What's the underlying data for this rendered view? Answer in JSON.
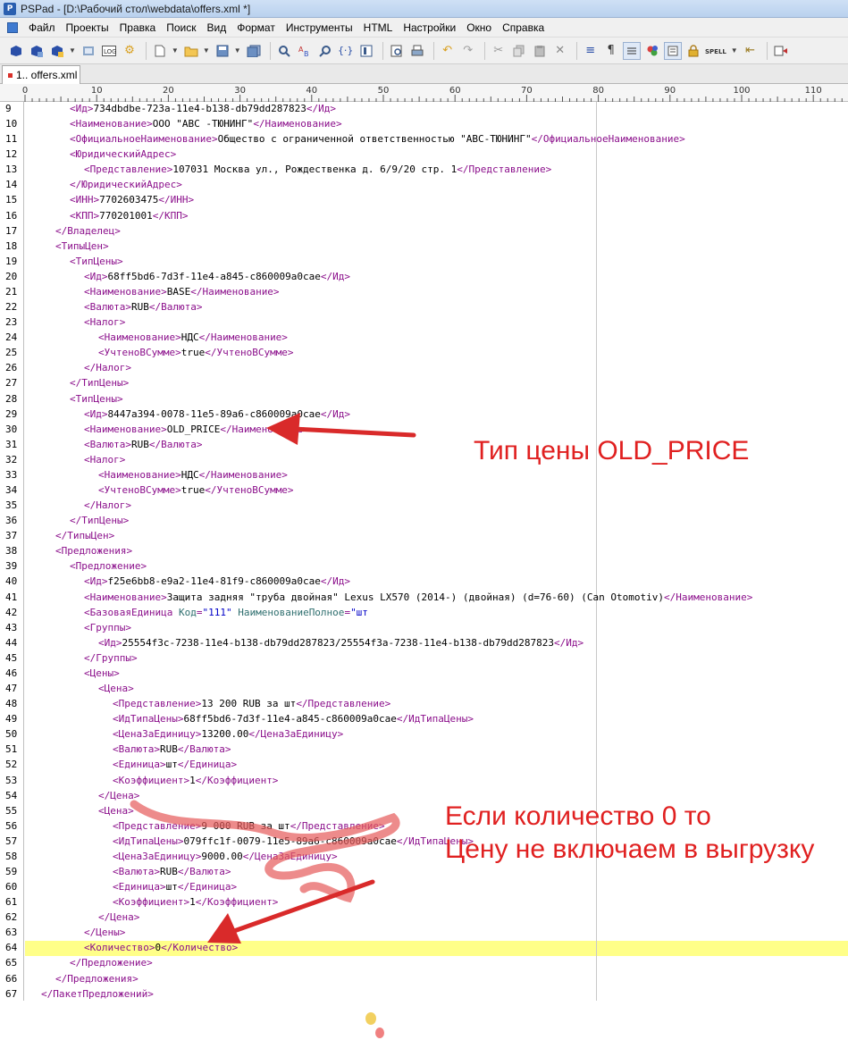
{
  "window": {
    "app_icon": "pspad-icon",
    "title": "PSPad - [D:\\Рабочий стол\\webdata\\offers.xml *]"
  },
  "menu": {
    "items": [
      "Файл",
      "Проекты",
      "Правка",
      "Поиск",
      "Вид",
      "Формат",
      "Инструменты",
      "HTML",
      "Настройки",
      "Окно",
      "Справка"
    ]
  },
  "toolbar": {
    "buttons": [
      "open-project-icon",
      "save-project-icon",
      "project-options-icon",
      "close-project-icon",
      "log-icon",
      "settings-icon",
      "new-file-icon",
      "open-file-icon",
      "save-icon",
      "save-all-icon",
      "find-icon",
      "replace-icon",
      "find-in-files-icon",
      "bookmark-icon",
      "preview-icon",
      "print-icon",
      "undo-icon",
      "redo-icon",
      "cut-icon",
      "copy-icon",
      "paste-icon",
      "delete-icon",
      "word-wrap-icon",
      "pilcrow-icon",
      "column-mode-icon",
      "color-icon",
      "hex-edit-icon",
      "lock-icon",
      "spell-icon",
      "macro-icon",
      "compile-icon"
    ],
    "spell_label": "SPELL",
    "log_label": "LOG"
  },
  "tabs": [
    {
      "label": "1.. offers.xml",
      "active": true
    }
  ],
  "ruler": {
    "labels": [
      "0",
      "10",
      "20",
      "30",
      "40",
      "50",
      "60",
      "70",
      "80",
      "90",
      "100",
      "110"
    ]
  },
  "editor": {
    "highlighted_line": 64,
    "lines": [
      {
        "n": "9",
        "indent": 3,
        "parts": [
          [
            "tg",
            "<Ид>"
          ],
          [
            "tx",
            "734dbdbe-723a-11e4-b138-db79dd287823"
          ],
          [
            "tg",
            "</Ид>"
          ]
        ]
      },
      {
        "n": "10",
        "indent": 3,
        "parts": [
          [
            "tg",
            "<Наименование>"
          ],
          [
            "tx",
            "ООО \"АВС -ТЮНИНГ\""
          ],
          [
            "tg",
            "</Наименование>"
          ]
        ]
      },
      {
        "n": "11",
        "indent": 3,
        "parts": [
          [
            "tg",
            "<ОфициальноеНаименование>"
          ],
          [
            "tx",
            "Общество с ограниченной ответственностью \"АВС-ТЮНИНГ\""
          ],
          [
            "tg",
            "</ОфициальноеНаименование>"
          ]
        ]
      },
      {
        "n": "12",
        "indent": 3,
        "parts": [
          [
            "tg",
            "<ЮридическийАдрес>"
          ]
        ]
      },
      {
        "n": "13",
        "indent": 4,
        "parts": [
          [
            "tg",
            "<Представление>"
          ],
          [
            "tx",
            "107031 Москва ул., Рождественка д. 6/9/20 стр. 1"
          ],
          [
            "tg",
            "</Представление>"
          ]
        ]
      },
      {
        "n": "14",
        "indent": 3,
        "parts": [
          [
            "tg",
            "</ЮридическийАдрес>"
          ]
        ]
      },
      {
        "n": "15",
        "indent": 3,
        "parts": [
          [
            "tg",
            "<ИНН>"
          ],
          [
            "tx",
            "7702603475"
          ],
          [
            "tg",
            "</ИНН>"
          ]
        ]
      },
      {
        "n": "16",
        "indent": 3,
        "parts": [
          [
            "tg",
            "<КПП>"
          ],
          [
            "tx",
            "770201001"
          ],
          [
            "tg",
            "</КПП>"
          ]
        ]
      },
      {
        "n": "17",
        "indent": 2,
        "parts": [
          [
            "tg",
            "</Владелец>"
          ]
        ]
      },
      {
        "n": "18",
        "indent": 2,
        "parts": [
          [
            "tg",
            "<ТипыЦен>"
          ]
        ]
      },
      {
        "n": "19",
        "indent": 3,
        "parts": [
          [
            "tg",
            "<ТипЦены>"
          ]
        ]
      },
      {
        "n": "20",
        "indent": 4,
        "parts": [
          [
            "tg",
            "<Ид>"
          ],
          [
            "tx",
            "68ff5bd6-7d3f-11e4-a845-c860009a0cae"
          ],
          [
            "tg",
            "</Ид>"
          ]
        ]
      },
      {
        "n": "21",
        "indent": 4,
        "parts": [
          [
            "tg",
            "<Наименование>"
          ],
          [
            "tx",
            "BASE"
          ],
          [
            "tg",
            "</Наименование>"
          ]
        ]
      },
      {
        "n": "22",
        "indent": 4,
        "parts": [
          [
            "tg",
            "<Валюта>"
          ],
          [
            "tx",
            "RUB"
          ],
          [
            "tg",
            "</Валюта>"
          ]
        ]
      },
      {
        "n": "23",
        "indent": 4,
        "parts": [
          [
            "tg",
            "<Налог>"
          ]
        ]
      },
      {
        "n": "24",
        "indent": 5,
        "parts": [
          [
            "tg",
            "<Наименование>"
          ],
          [
            "tx",
            "НДС"
          ],
          [
            "tg",
            "</Наименование>"
          ]
        ]
      },
      {
        "n": "25",
        "indent": 5,
        "parts": [
          [
            "tg",
            "<УчтеноВСумме>"
          ],
          [
            "tx",
            "true"
          ],
          [
            "tg",
            "</УчтеноВСумме>"
          ]
        ]
      },
      {
        "n": "26",
        "indent": 4,
        "parts": [
          [
            "tg",
            "</Налог>"
          ]
        ]
      },
      {
        "n": "27",
        "indent": 3,
        "parts": [
          [
            "tg",
            "</ТипЦены>"
          ]
        ]
      },
      {
        "n": "28",
        "indent": 3,
        "parts": [
          [
            "tg",
            "<ТипЦены>"
          ]
        ]
      },
      {
        "n": "29",
        "indent": 4,
        "parts": [
          [
            "tg",
            "<Ид>"
          ],
          [
            "tx",
            "8447a394-0078-11e5-89a6-c860009a0cae"
          ],
          [
            "tg",
            "</Ид>"
          ]
        ]
      },
      {
        "n": "30",
        "indent": 4,
        "parts": [
          [
            "tg",
            "<Наименование>"
          ],
          [
            "tx",
            "OLD_PRICE"
          ],
          [
            "tg",
            "</Наименование>"
          ]
        ]
      },
      {
        "n": "31",
        "indent": 4,
        "parts": [
          [
            "tg",
            "<Валюта>"
          ],
          [
            "tx",
            "RUB"
          ],
          [
            "tg",
            "</Валюта>"
          ]
        ]
      },
      {
        "n": "32",
        "indent": 4,
        "parts": [
          [
            "tg",
            "<Налог>"
          ]
        ]
      },
      {
        "n": "33",
        "indent": 5,
        "parts": [
          [
            "tg",
            "<Наименование>"
          ],
          [
            "tx",
            "НДС"
          ],
          [
            "tg",
            "</Наименование>"
          ]
        ]
      },
      {
        "n": "34",
        "indent": 5,
        "parts": [
          [
            "tg",
            "<УчтеноВСумме>"
          ],
          [
            "tx",
            "true"
          ],
          [
            "tg",
            "</УчтеноВСумме>"
          ]
        ]
      },
      {
        "n": "35",
        "indent": 4,
        "parts": [
          [
            "tg",
            "</Налог>"
          ]
        ]
      },
      {
        "n": "36",
        "indent": 3,
        "parts": [
          [
            "tg",
            "</ТипЦены>"
          ]
        ]
      },
      {
        "n": "37",
        "indent": 2,
        "parts": [
          [
            "tg",
            "</ТипыЦен>"
          ]
        ]
      },
      {
        "n": "38",
        "indent": 2,
        "parts": [
          [
            "tg",
            "<Предложения>"
          ]
        ]
      },
      {
        "n": "39",
        "indent": 3,
        "parts": [
          [
            "tg",
            "<Предложение>"
          ]
        ]
      },
      {
        "n": "40",
        "indent": 4,
        "parts": [
          [
            "tg",
            "<Ид>"
          ],
          [
            "tx",
            "f25e6bb8-e9a2-11e4-81f9-c860009a0cae"
          ],
          [
            "tg",
            "</Ид>"
          ]
        ]
      },
      {
        "n": "41",
        "indent": 4,
        "parts": [
          [
            "tg",
            "<Наименование>"
          ],
          [
            "tx",
            "Защита задняя \"труба двойная\" Lexus LX570 (2014-) (двойная) (d=76-60) (Can Otomotiv)"
          ],
          [
            "tg",
            "</Наименование>"
          ]
        ]
      },
      {
        "n": "42",
        "indent": 4,
        "parts": [
          [
            "tg",
            "<БазоваяЕдиница "
          ],
          [
            "at",
            "Код"
          ],
          [
            "tg",
            "="
          ],
          [
            "av",
            "\"111\""
          ],
          [
            "tg",
            " "
          ],
          [
            "at",
            "НаименованиеПолное"
          ],
          [
            "tg",
            "="
          ],
          [
            "av",
            "\"шт"
          ]
        ]
      },
      {
        "n": "43",
        "indent": 4,
        "parts": [
          [
            "tg",
            "<Группы>"
          ]
        ]
      },
      {
        "n": "44",
        "indent": 5,
        "parts": [
          [
            "tg",
            "<Ид>"
          ],
          [
            "tx",
            "25554f3c-7238-11e4-b138-db79dd287823/25554f3a-7238-11e4-b138-db79dd287823"
          ],
          [
            "tg",
            "</Ид>"
          ]
        ]
      },
      {
        "n": "45",
        "indent": 4,
        "parts": [
          [
            "tg",
            "</Группы>"
          ]
        ]
      },
      {
        "n": "46",
        "indent": 4,
        "parts": [
          [
            "tg",
            "<Цены>"
          ]
        ]
      },
      {
        "n": "47",
        "indent": 5,
        "parts": [
          [
            "tg",
            "<Цена>"
          ]
        ]
      },
      {
        "n": "48",
        "indent": 6,
        "parts": [
          [
            "tg",
            "<Представление>"
          ],
          [
            "tx",
            "13 200 RUB за шт"
          ],
          [
            "tg",
            "</Представление>"
          ]
        ]
      },
      {
        "n": "49",
        "indent": 6,
        "parts": [
          [
            "tg",
            "<ИдТипаЦены>"
          ],
          [
            "tx",
            "68ff5bd6-7d3f-11e4-a845-c860009a0cae"
          ],
          [
            "tg",
            "</ИдТипаЦены>"
          ]
        ]
      },
      {
        "n": "50",
        "indent": 6,
        "parts": [
          [
            "tg",
            "<ЦенаЗаЕдиницу>"
          ],
          [
            "tx",
            "13200.00"
          ],
          [
            "tg",
            "</ЦенаЗаЕдиницу>"
          ]
        ]
      },
      {
        "n": "51",
        "indent": 6,
        "parts": [
          [
            "tg",
            "<Валюта>"
          ],
          [
            "tx",
            "RUB"
          ],
          [
            "tg",
            "</Валюта>"
          ]
        ]
      },
      {
        "n": "52",
        "indent": 6,
        "parts": [
          [
            "tg",
            "<Единица>"
          ],
          [
            "tx",
            "шт"
          ],
          [
            "tg",
            "</Единица>"
          ]
        ]
      },
      {
        "n": "53",
        "indent": 6,
        "parts": [
          [
            "tg",
            "<Коэффициент>"
          ],
          [
            "tx",
            "1"
          ],
          [
            "tg",
            "</Коэффициент>"
          ]
        ]
      },
      {
        "n": "54",
        "indent": 5,
        "parts": [
          [
            "tg",
            "</Цена>"
          ]
        ]
      },
      {
        "n": "55",
        "indent": 5,
        "parts": [
          [
            "tg",
            "<Цена>"
          ]
        ]
      },
      {
        "n": "56",
        "indent": 6,
        "parts": [
          [
            "tg",
            "<Представление>"
          ],
          [
            "tx",
            "9 000 RUB за шт"
          ],
          [
            "tg",
            "</Представление>"
          ]
        ]
      },
      {
        "n": "57",
        "indent": 6,
        "parts": [
          [
            "tg",
            "<ИдТипаЦены>"
          ],
          [
            "tx",
            "079ffc1f-0079-11e5-89a6-c860009a0cae"
          ],
          [
            "tg",
            "</ИдТипаЦены>"
          ]
        ]
      },
      {
        "n": "58",
        "indent": 6,
        "parts": [
          [
            "tg",
            "<ЦенаЗаЕдиницу>"
          ],
          [
            "tx",
            "9000.00"
          ],
          [
            "tg",
            "</ЦенаЗаЕдиницу>"
          ]
        ]
      },
      {
        "n": "59",
        "indent": 6,
        "parts": [
          [
            "tg",
            "<Валюта>"
          ],
          [
            "tx",
            "RUB"
          ],
          [
            "tg",
            "</Валюта>"
          ]
        ]
      },
      {
        "n": "60",
        "indent": 6,
        "parts": [
          [
            "tg",
            "<Единица>"
          ],
          [
            "tx",
            "шт"
          ],
          [
            "tg",
            "</Единица>"
          ]
        ]
      },
      {
        "n": "61",
        "indent": 6,
        "parts": [
          [
            "tg",
            "<Коэффициент>"
          ],
          [
            "tx",
            "1"
          ],
          [
            "tg",
            "</Коэффициент>"
          ]
        ]
      },
      {
        "n": "62",
        "indent": 5,
        "parts": [
          [
            "tg",
            "</Цена>"
          ]
        ]
      },
      {
        "n": "63",
        "indent": 4,
        "parts": [
          [
            "tg",
            "</Цены>"
          ]
        ]
      },
      {
        "n": "64",
        "indent": 4,
        "parts": [
          [
            "tg",
            "<Количество>"
          ],
          [
            "tx",
            "0"
          ],
          [
            "tg",
            "</Количество>"
          ]
        ]
      },
      {
        "n": "65",
        "indent": 3,
        "parts": [
          [
            "tg",
            "</Предложение>"
          ]
        ]
      },
      {
        "n": "66",
        "indent": 2,
        "parts": [
          [
            "tg",
            "</Предложения>"
          ]
        ]
      },
      {
        "n": "67",
        "indent": 1,
        "parts": [
          [
            "tg",
            "</ПакетПредложений>"
          ]
        ]
      }
    ]
  },
  "annotations": {
    "note_price_type": "Тип цены OLD_PRICE",
    "note_quantity_line1": "Если количество 0 то",
    "note_quantity_line2": "Цену не включаем в выгрузку",
    "color": "#e02020"
  },
  "colors": {
    "tag": "#8b0f8b",
    "text": "#000000",
    "attr_name": "#2f6f6f",
    "attr_value": "#0000c8",
    "current_line": "#ffff88"
  }
}
